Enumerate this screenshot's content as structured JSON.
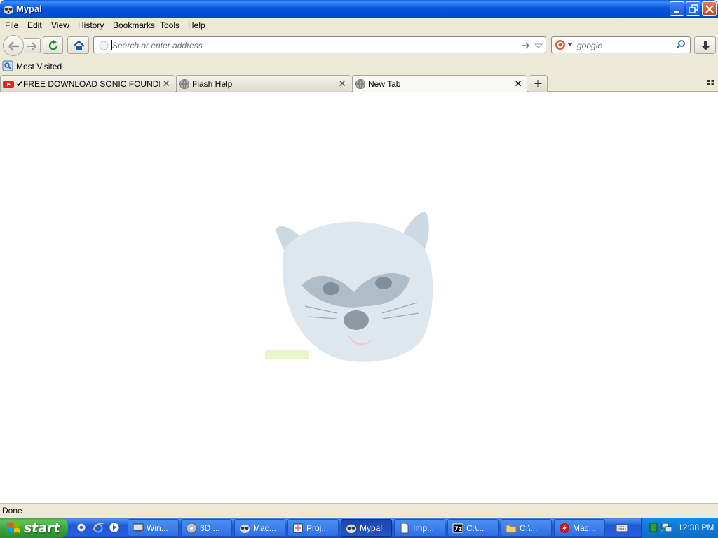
{
  "window": {
    "title": "Mypal"
  },
  "menu": [
    "File",
    "Edit",
    "View",
    "History",
    "Bookmarks",
    "Tools",
    "Help"
  ],
  "nav": {
    "url_placeholder": "Search or enter address",
    "search_placeholder": "google"
  },
  "bookmarks": {
    "most_visited": "Most Visited"
  },
  "tabs": [
    {
      "label": "✔FREE DOWNLOAD SONIC FOUNDRY V...",
      "icon": "youtube-icon"
    },
    {
      "label": "Flash Help",
      "icon": "globe-icon"
    },
    {
      "label": "New Tab",
      "icon": "globe-icon",
      "active": true
    }
  ],
  "content": {
    "logo_icon": "mypal-raccoon-logo"
  },
  "status": {
    "text": "Done"
  },
  "taskbar": {
    "start_label": "start",
    "tasks": [
      {
        "label": "Win...",
        "icon": "computer-icon"
      },
      {
        "label": "3D ...",
        "icon": "disc-icon"
      },
      {
        "label": "Mac...",
        "icon": "raccoon-icon"
      },
      {
        "label": "Proj...",
        "icon": "project-icon"
      },
      {
        "label": "Mypal",
        "icon": "raccoon-icon",
        "active": true
      },
      {
        "label": "Imp...",
        "icon": "document-icon"
      },
      {
        "label": "C:\\...",
        "icon": "7zip-icon"
      },
      {
        "label": "C:\\...",
        "icon": "folder-icon"
      },
      {
        "label": "Mac...",
        "icon": "flash-icon"
      }
    ],
    "clock": "12:38 PM"
  }
}
